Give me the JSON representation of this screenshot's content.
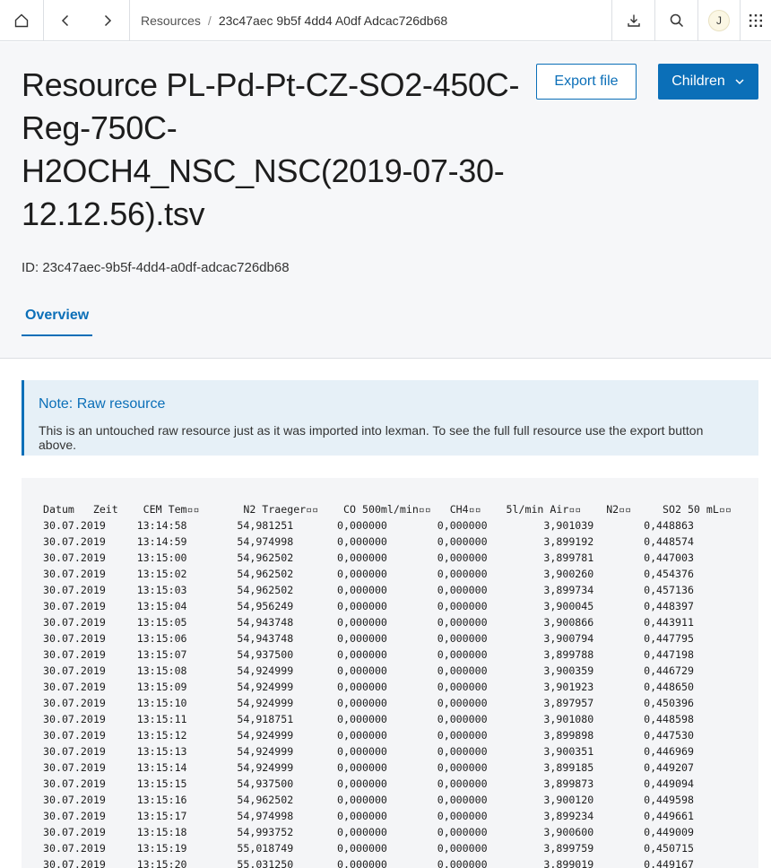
{
  "topbar": {
    "home_icon": "home-icon",
    "back_icon": "chevron-left-icon",
    "forward_icon": "chevron-right-icon",
    "breadcrumb": {
      "parent": "Resources",
      "separator": "/",
      "current": "23c47aec 9b5f 4dd4 A0df Adcac726db68"
    },
    "download_icon": "download-icon",
    "search_icon": "search-icon",
    "avatar_initial": "J",
    "apps_icon": "grid-icon"
  },
  "header": {
    "title": "Resource PL-Pd-Pt-CZ-SO2-450C-Reg-750C-H2OCH4_NSC_NSC(2019-07-30-12.12.56).tsv",
    "id_text": "ID: 23c47aec-9b5f-4dd4-a0df-adcac726db68",
    "export_label": "Export file",
    "children_label": "Children",
    "tabs": [
      {
        "label": "Overview",
        "active": true
      }
    ]
  },
  "note": {
    "title": "Note: Raw resource",
    "body": "This is an untouched raw resource just as it was imported into lexman. To see the full full resource use the export button above."
  },
  "raw": {
    "header_line": "Datum   Zeit    CEM Tem▫▫       N2 Traeger▫▫    CO 500ml/min▫▫   CH4▫▫    5l/min Air▫▫    N2▫▫     SO2 50 mL▫▫",
    "rows": [
      [
        "30.07.2019",
        "13:14:58",
        "54,981251",
        "0,000000",
        "0,000000",
        "3,901039",
        "0,448863"
      ],
      [
        "30.07.2019",
        "13:14:59",
        "54,974998",
        "0,000000",
        "0,000000",
        "3,899192",
        "0,448574"
      ],
      [
        "30.07.2019",
        "13:15:00",
        "54,962502",
        "0,000000",
        "0,000000",
        "3,899781",
        "0,447003"
      ],
      [
        "30.07.2019",
        "13:15:02",
        "54,962502",
        "0,000000",
        "0,000000",
        "3,900260",
        "0,454376"
      ],
      [
        "30.07.2019",
        "13:15:03",
        "54,962502",
        "0,000000",
        "0,000000",
        "3,899734",
        "0,457136"
      ],
      [
        "30.07.2019",
        "13:15:04",
        "54,956249",
        "0,000000",
        "0,000000",
        "3,900045",
        "0,448397"
      ],
      [
        "30.07.2019",
        "13:15:05",
        "54,943748",
        "0,000000",
        "0,000000",
        "3,900866",
        "0,443911"
      ],
      [
        "30.07.2019",
        "13:15:06",
        "54,943748",
        "0,000000",
        "0,000000",
        "3,900794",
        "0,447795"
      ],
      [
        "30.07.2019",
        "13:15:07",
        "54,937500",
        "0,000000",
        "0,000000",
        "3,899788",
        "0,447198"
      ],
      [
        "30.07.2019",
        "13:15:08",
        "54,924999",
        "0,000000",
        "0,000000",
        "3,900359",
        "0,446729"
      ],
      [
        "30.07.2019",
        "13:15:09",
        "54,924999",
        "0,000000",
        "0,000000",
        "3,901923",
        "0,448650"
      ],
      [
        "30.07.2019",
        "13:15:10",
        "54,924999",
        "0,000000",
        "0,000000",
        "3,897957",
        "0,450396"
      ],
      [
        "30.07.2019",
        "13:15:11",
        "54,918751",
        "0,000000",
        "0,000000",
        "3,901080",
        "0,448598"
      ],
      [
        "30.07.2019",
        "13:15:12",
        "54,924999",
        "0,000000",
        "0,000000",
        "3,899898",
        "0,447530"
      ],
      [
        "30.07.2019",
        "13:15:13",
        "54,924999",
        "0,000000",
        "0,000000",
        "3,900351",
        "0,446969"
      ],
      [
        "30.07.2019",
        "13:15:14",
        "54,924999",
        "0,000000",
        "0,000000",
        "3,899185",
        "0,449207"
      ],
      [
        "30.07.2019",
        "13:15:15",
        "54,937500",
        "0,000000",
        "0,000000",
        "3,899873",
        "0,449094"
      ],
      [
        "30.07.2019",
        "13:15:16",
        "54,962502",
        "0,000000",
        "0,000000",
        "3,900120",
        "0,449598"
      ],
      [
        "30.07.2019",
        "13:15:17",
        "54,974998",
        "0,000000",
        "0,000000",
        "3,899234",
        "0,449661"
      ],
      [
        "30.07.2019",
        "13:15:18",
        "54,993752",
        "0,000000",
        "0,000000",
        "3,900600",
        "0,449009"
      ],
      [
        "30.07.2019",
        "13:15:19",
        "55,018749",
        "0,000000",
        "0,000000",
        "3,899759",
        "0,450715"
      ],
      [
        "30.07.2019",
        "13:15:20",
        "55,031250",
        "0,000000",
        "0,000000",
        "3,899019",
        "0,449167"
      ]
    ]
  },
  "colors": {
    "accent": "#0b6fb8",
    "header_bg": "#f6f7f9",
    "note_bg": "#e6f0f7",
    "raw_bg": "#f4f5f7"
  }
}
